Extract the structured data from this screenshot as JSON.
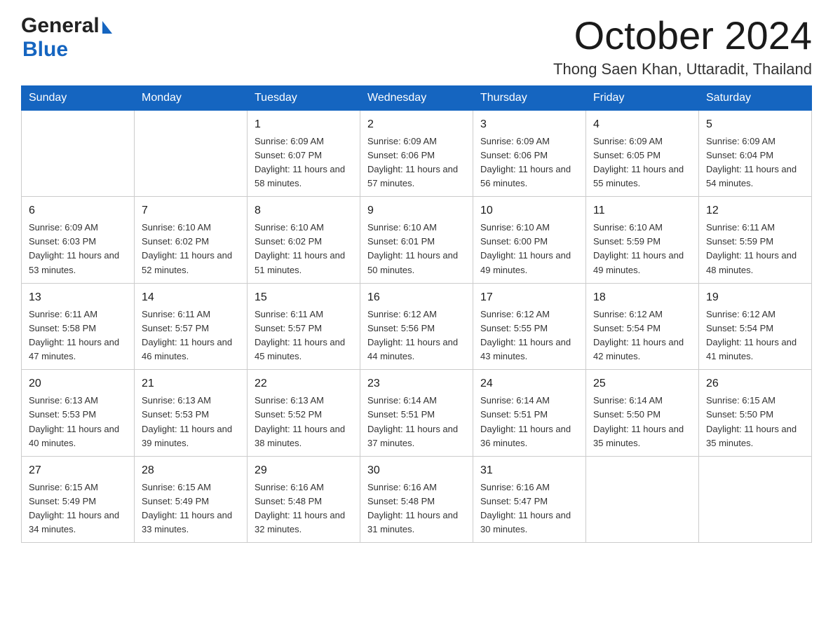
{
  "header": {
    "month_title": "October 2024",
    "location": "Thong Saen Khan, Uttaradit, Thailand",
    "logo_general": "General",
    "logo_blue": "Blue"
  },
  "weekdays": [
    "Sunday",
    "Monday",
    "Tuesday",
    "Wednesday",
    "Thursday",
    "Friday",
    "Saturday"
  ],
  "weeks": [
    [
      {
        "day": "",
        "sunrise": "",
        "sunset": "",
        "daylight": ""
      },
      {
        "day": "",
        "sunrise": "",
        "sunset": "",
        "daylight": ""
      },
      {
        "day": "1",
        "sunrise": "Sunrise: 6:09 AM",
        "sunset": "Sunset: 6:07 PM",
        "daylight": "Daylight: 11 hours and 58 minutes."
      },
      {
        "day": "2",
        "sunrise": "Sunrise: 6:09 AM",
        "sunset": "Sunset: 6:06 PM",
        "daylight": "Daylight: 11 hours and 57 minutes."
      },
      {
        "day": "3",
        "sunrise": "Sunrise: 6:09 AM",
        "sunset": "Sunset: 6:06 PM",
        "daylight": "Daylight: 11 hours and 56 minutes."
      },
      {
        "day": "4",
        "sunrise": "Sunrise: 6:09 AM",
        "sunset": "Sunset: 6:05 PM",
        "daylight": "Daylight: 11 hours and 55 minutes."
      },
      {
        "day": "5",
        "sunrise": "Sunrise: 6:09 AM",
        "sunset": "Sunset: 6:04 PM",
        "daylight": "Daylight: 11 hours and 54 minutes."
      }
    ],
    [
      {
        "day": "6",
        "sunrise": "Sunrise: 6:09 AM",
        "sunset": "Sunset: 6:03 PM",
        "daylight": "Daylight: 11 hours and 53 minutes."
      },
      {
        "day": "7",
        "sunrise": "Sunrise: 6:10 AM",
        "sunset": "Sunset: 6:02 PM",
        "daylight": "Daylight: 11 hours and 52 minutes."
      },
      {
        "day": "8",
        "sunrise": "Sunrise: 6:10 AM",
        "sunset": "Sunset: 6:02 PM",
        "daylight": "Daylight: 11 hours and 51 minutes."
      },
      {
        "day": "9",
        "sunrise": "Sunrise: 6:10 AM",
        "sunset": "Sunset: 6:01 PM",
        "daylight": "Daylight: 11 hours and 50 minutes."
      },
      {
        "day": "10",
        "sunrise": "Sunrise: 6:10 AM",
        "sunset": "Sunset: 6:00 PM",
        "daylight": "Daylight: 11 hours and 49 minutes."
      },
      {
        "day": "11",
        "sunrise": "Sunrise: 6:10 AM",
        "sunset": "Sunset: 5:59 PM",
        "daylight": "Daylight: 11 hours and 49 minutes."
      },
      {
        "day": "12",
        "sunrise": "Sunrise: 6:11 AM",
        "sunset": "Sunset: 5:59 PM",
        "daylight": "Daylight: 11 hours and 48 minutes."
      }
    ],
    [
      {
        "day": "13",
        "sunrise": "Sunrise: 6:11 AM",
        "sunset": "Sunset: 5:58 PM",
        "daylight": "Daylight: 11 hours and 47 minutes."
      },
      {
        "day": "14",
        "sunrise": "Sunrise: 6:11 AM",
        "sunset": "Sunset: 5:57 PM",
        "daylight": "Daylight: 11 hours and 46 minutes."
      },
      {
        "day": "15",
        "sunrise": "Sunrise: 6:11 AM",
        "sunset": "Sunset: 5:57 PM",
        "daylight": "Daylight: 11 hours and 45 minutes."
      },
      {
        "day": "16",
        "sunrise": "Sunrise: 6:12 AM",
        "sunset": "Sunset: 5:56 PM",
        "daylight": "Daylight: 11 hours and 44 minutes."
      },
      {
        "day": "17",
        "sunrise": "Sunrise: 6:12 AM",
        "sunset": "Sunset: 5:55 PM",
        "daylight": "Daylight: 11 hours and 43 minutes."
      },
      {
        "day": "18",
        "sunrise": "Sunrise: 6:12 AM",
        "sunset": "Sunset: 5:54 PM",
        "daylight": "Daylight: 11 hours and 42 minutes."
      },
      {
        "day": "19",
        "sunrise": "Sunrise: 6:12 AM",
        "sunset": "Sunset: 5:54 PM",
        "daylight": "Daylight: 11 hours and 41 minutes."
      }
    ],
    [
      {
        "day": "20",
        "sunrise": "Sunrise: 6:13 AM",
        "sunset": "Sunset: 5:53 PM",
        "daylight": "Daylight: 11 hours and 40 minutes."
      },
      {
        "day": "21",
        "sunrise": "Sunrise: 6:13 AM",
        "sunset": "Sunset: 5:53 PM",
        "daylight": "Daylight: 11 hours and 39 minutes."
      },
      {
        "day": "22",
        "sunrise": "Sunrise: 6:13 AM",
        "sunset": "Sunset: 5:52 PM",
        "daylight": "Daylight: 11 hours and 38 minutes."
      },
      {
        "day": "23",
        "sunrise": "Sunrise: 6:14 AM",
        "sunset": "Sunset: 5:51 PM",
        "daylight": "Daylight: 11 hours and 37 minutes."
      },
      {
        "day": "24",
        "sunrise": "Sunrise: 6:14 AM",
        "sunset": "Sunset: 5:51 PM",
        "daylight": "Daylight: 11 hours and 36 minutes."
      },
      {
        "day": "25",
        "sunrise": "Sunrise: 6:14 AM",
        "sunset": "Sunset: 5:50 PM",
        "daylight": "Daylight: 11 hours and 35 minutes."
      },
      {
        "day": "26",
        "sunrise": "Sunrise: 6:15 AM",
        "sunset": "Sunset: 5:50 PM",
        "daylight": "Daylight: 11 hours and 35 minutes."
      }
    ],
    [
      {
        "day": "27",
        "sunrise": "Sunrise: 6:15 AM",
        "sunset": "Sunset: 5:49 PM",
        "daylight": "Daylight: 11 hours and 34 minutes."
      },
      {
        "day": "28",
        "sunrise": "Sunrise: 6:15 AM",
        "sunset": "Sunset: 5:49 PM",
        "daylight": "Daylight: 11 hours and 33 minutes."
      },
      {
        "day": "29",
        "sunrise": "Sunrise: 6:16 AM",
        "sunset": "Sunset: 5:48 PM",
        "daylight": "Daylight: 11 hours and 32 minutes."
      },
      {
        "day": "30",
        "sunrise": "Sunrise: 6:16 AM",
        "sunset": "Sunset: 5:48 PM",
        "daylight": "Daylight: 11 hours and 31 minutes."
      },
      {
        "day": "31",
        "sunrise": "Sunrise: 6:16 AM",
        "sunset": "Sunset: 5:47 PM",
        "daylight": "Daylight: 11 hours and 30 minutes."
      },
      {
        "day": "",
        "sunrise": "",
        "sunset": "",
        "daylight": ""
      },
      {
        "day": "",
        "sunrise": "",
        "sunset": "",
        "daylight": ""
      }
    ]
  ]
}
